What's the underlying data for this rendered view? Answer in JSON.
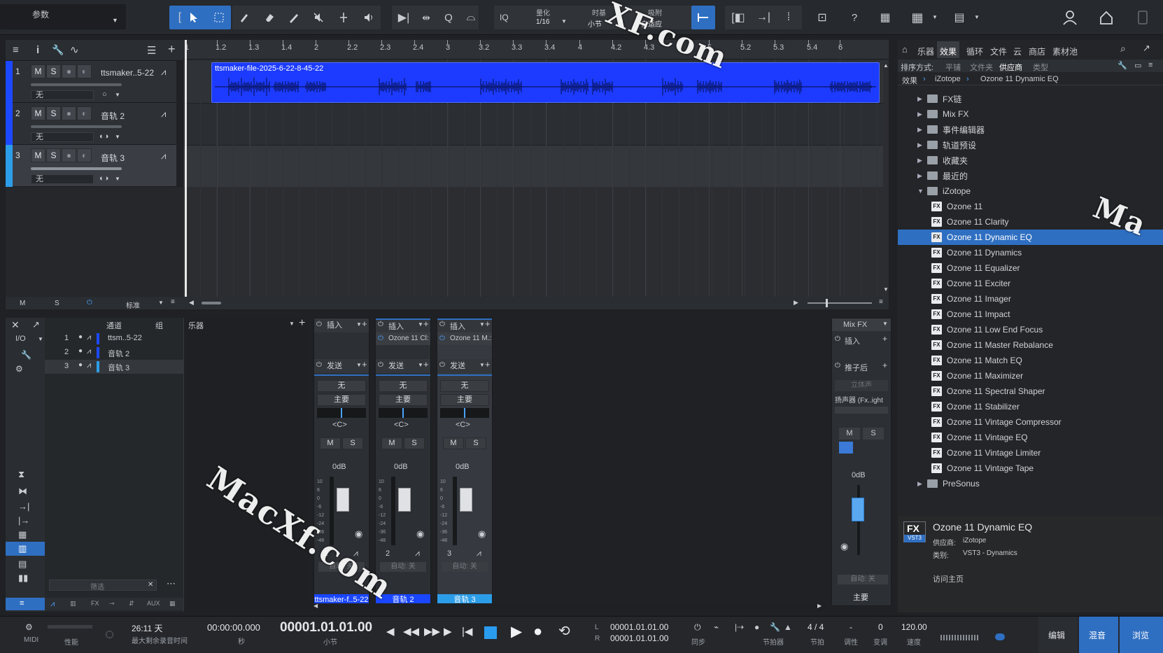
{
  "toolbar": {
    "params_label": "参数",
    "iq_label": "IQ",
    "quantize_label": "量化",
    "quantize_value": "1/16",
    "timebase_label": "时基",
    "timebase_value": "小节",
    "snap_label": "吸附",
    "snap_value": "自适应",
    "help_label": "?"
  },
  "tracks": [
    {
      "num": "1",
      "name": "ttsmaker..5-22",
      "input": "无"
    },
    {
      "num": "2",
      "name": "音轨 2",
      "input": "无"
    },
    {
      "num": "3",
      "name": "音轨 3",
      "input": "无"
    }
  ],
  "track_footer": {
    "m": "M",
    "s": "S",
    "view": "标准"
  },
  "ruler": [
    "1",
    "1.2",
    "1.3",
    "1.4",
    "2",
    "2.2",
    "2.3",
    "2.4",
    "3",
    "3.2",
    "3.3",
    "3.4",
    "4",
    "4.2",
    "4.3",
    "5",
    "5.2",
    "5.3",
    "5.4",
    "6"
  ],
  "clip": {
    "name": "ttsmaker-file-2025-6-22-8-45-22"
  },
  "browser": {
    "tabs": [
      "乐器",
      "效果",
      "循环",
      "文件",
      "云",
      "商店",
      "素材池"
    ],
    "active_tab": "效果",
    "sort_label": "排序方式:",
    "sort_options": [
      "平铺",
      "文件夹",
      "供应商",
      "类型"
    ],
    "breadcrumb": [
      "效果",
      "iZotope",
      "Ozone 11 Dynamic EQ"
    ],
    "folders": [
      "FX链",
      "Mix FX",
      "事件编辑器",
      "轨道预设",
      "收藏夹",
      "最近的"
    ],
    "open_folder": "iZotope",
    "plugins": [
      "Ozone 11",
      "Ozone 11 Clarity",
      "Ozone 11 Dynamic EQ",
      "Ozone 11 Dynamics",
      "Ozone 11 Equalizer",
      "Ozone 11 Exciter",
      "Ozone 11 Imager",
      "Ozone 11 Impact",
      "Ozone 11 Low End Focus",
      "Ozone 11 Master Rebalance",
      "Ozone 11 Match EQ",
      "Ozone 11 Maximizer",
      "Ozone 11 Spectral Shaper",
      "Ozone 11 Stabilizer",
      "Ozone 11 Vintage Compressor",
      "Ozone 11 Vintage EQ",
      "Ozone 11 Vintage Limiter",
      "Ozone 11 Vintage Tape"
    ],
    "selected_plugin": "Ozone 11 Dynamic EQ",
    "last_folder": "PreSonus",
    "info": {
      "badge": "FX",
      "badge_sub": "VST3",
      "title": "Ozone 11 Dynamic EQ",
      "vendor_label": "供应商:",
      "vendor": "iZotope",
      "category_label": "类别:",
      "category": "VST3 - Dynamics",
      "homepage": "访问主页"
    }
  },
  "mixer_list": {
    "col_channel": "通道",
    "col_group": "组",
    "col_instrument": "乐器",
    "io_label": "I/O",
    "rows": [
      {
        "num": "1",
        "name": "ttsm..5-22"
      },
      {
        "num": "2",
        "name": "音轨 2"
      },
      {
        "num": "3",
        "name": "音轨 3"
      }
    ],
    "filter_placeholder": "筛选",
    "bottom_tabs": [
      "FX",
      "AUX"
    ]
  },
  "channels": [
    {
      "insert": "插入",
      "plugin": "",
      "send": "发送",
      "input": "无",
      "output": "主要",
      "pan": "<C>",
      "m": "M",
      "s": "S",
      "level": "0dB",
      "num": "1",
      "auto": "自动: 关",
      "name": "ttsmaker-f..5-22"
    },
    {
      "insert": "插入",
      "plugin": "Ozone 11 Cl:",
      "send": "发送",
      "input": "无",
      "output": "主要",
      "pan": "<C>",
      "m": "M",
      "s": "S",
      "level": "0dB",
      "num": "2",
      "auto": "自动: 关",
      "name": "音轨 2"
    },
    {
      "insert": "插入",
      "plugin": "Ozone 11 M.:",
      "send": "发送",
      "input": "无",
      "output": "主要",
      "pan": "<C>",
      "m": "M",
      "s": "S",
      "level": "0dB",
      "num": "3",
      "auto": "自动: 关",
      "name": "音轨 3"
    }
  ],
  "master": {
    "mixfx": "Mix FX",
    "insert": "插入",
    "postfader": "推子后",
    "stereo": "立体声",
    "speaker": "扬声器 (Fx..ight",
    "m": "M",
    "s": "S",
    "level": "0dB",
    "auto": "自动: 关",
    "name": "主要"
  },
  "fader_scale": [
    "10",
    "6",
    "0",
    "-6",
    "-12",
    "-24",
    "-36",
    "-48"
  ],
  "transport": {
    "midi": "MIDI",
    "perf": "性能",
    "rec_time": "26:11 天",
    "rec_time_label": "最大剩余录音时间",
    "sec_time": "00:00:00.000",
    "sec_label": "秒",
    "position": "00001.01.01.00",
    "position_label": "小节",
    "loop_l": "00001.01.01.00",
    "loop_r": "00001.01.01.00",
    "sync": "同步",
    "metronome": "节拍器",
    "signature": "4 / 4",
    "signature_label": "节拍",
    "key": "-",
    "key_label": "调性",
    "transpose": "0",
    "transpose_label": "变调",
    "tempo": "120.00",
    "tempo_label": "速度",
    "views": [
      "编辑",
      "混音",
      "浏览"
    ]
  },
  "watermarks": [
    "MacXf.com",
    "XF.com",
    "Ma"
  ]
}
